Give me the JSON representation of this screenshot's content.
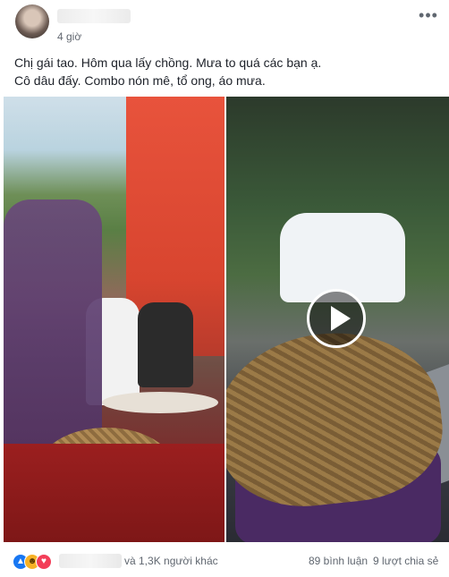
{
  "post": {
    "timestamp": "4 giờ",
    "text_lines": [
      "Chị gái tao. Hôm qua lấy chồng. Mưa to quá các bạn ạ.",
      "Cô dâu đấy. Combo nón mê, tổ ong, áo mưa."
    ]
  },
  "icons": {
    "more": "more-options-icon",
    "play": "play-icon",
    "like": "like-reaction-icon",
    "haha": "haha-reaction-icon",
    "love": "love-reaction-icon"
  },
  "colors": {
    "like": "#1877f2",
    "haha": "#f7b125",
    "love": "#f33e58",
    "meta_text": "#606770"
  },
  "footer": {
    "reactions_others": "và 1,3K người khác",
    "comments": "89 bình luận",
    "shares": "9 lượt chia sẻ"
  }
}
